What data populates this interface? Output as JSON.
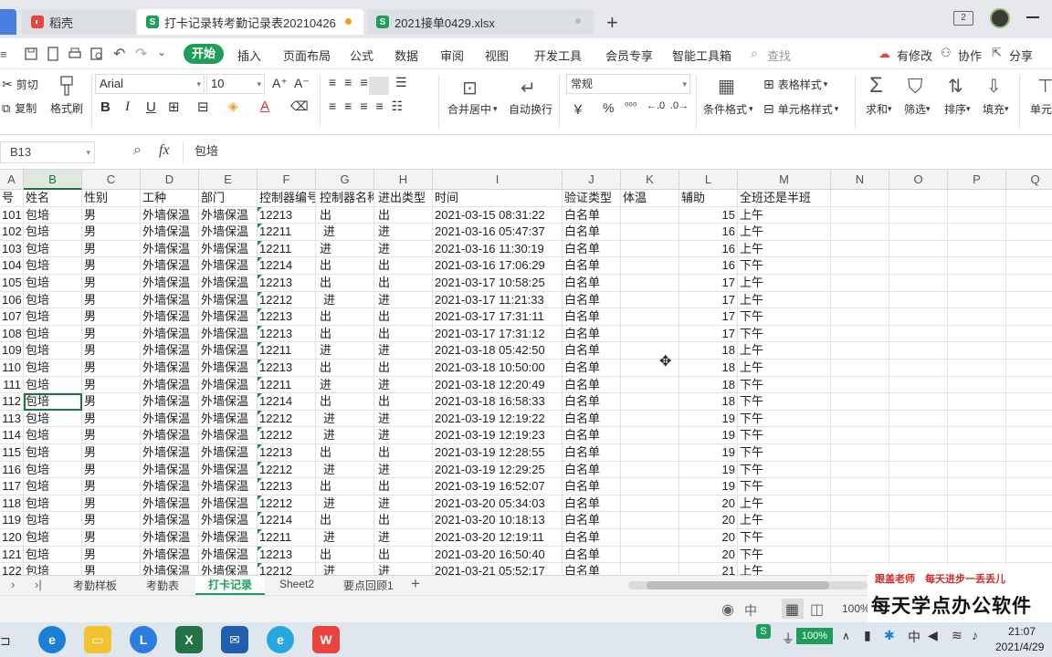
{
  "tabs": [
    {
      "label": "稻壳"
    },
    {
      "label": "打卡记录转考勤记录表20210426"
    },
    {
      "label": "2021接单0429.xlsx"
    }
  ],
  "tab_badge": "2",
  "menu": [
    "开始",
    "插入",
    "页面布局",
    "公式",
    "数据",
    "审阅",
    "视图",
    "开发工具",
    "会员专享",
    "智能工具箱"
  ],
  "search_label": "查找",
  "right_menu": [
    "有修改",
    "协作",
    "分享"
  ],
  "ribbon": {
    "cut": "剪切",
    "copy": "复制",
    "format_painter": "格式刷",
    "font_name": "Arial",
    "font_size": "10",
    "bold": "B",
    "italic": "I",
    "underline": "U",
    "merge": "合并居中",
    "wrap": "自动换行",
    "number_format": "常规",
    "currency": "￥",
    "percent": "%",
    "table_style": "表格样式",
    "cond_format": "条件格式",
    "cell_style": "单元格样式",
    "sum": "求和",
    "filter": "筛选",
    "sort": "排序",
    "fill": "填充",
    "cell": "单元"
  },
  "formula": {
    "cell_ref": "B13",
    "fx": "fx",
    "value": "包培"
  },
  "columns": [
    "A",
    "B",
    "C",
    "D",
    "E",
    "F",
    "G",
    "H",
    "I",
    "J",
    "K",
    "L",
    "M",
    "N",
    "O",
    "P",
    "Q"
  ],
  "header_row": [
    "号",
    "姓名",
    "性别",
    "工种",
    "部门",
    "控制器编号",
    "控制器名称",
    "进出类型",
    "时间",
    "验证类型",
    "体温",
    "辅助",
    "全班还是半班"
  ],
  "rows": [
    [
      "101",
      "包培",
      "男",
      "外墙保温",
      "外墙保温",
      "12213",
      "出",
      "出",
      "2021-03-15 08:31:22",
      "白名单",
      "",
      "15",
      "上午"
    ],
    [
      "102",
      "包培",
      "男",
      "外墙保温",
      "外墙保温",
      "12211",
      "进",
      "进",
      "2021-03-16 05:47:37",
      "白名单",
      "",
      "16",
      "上午"
    ],
    [
      "103",
      "包培",
      "男",
      "外墙保温",
      "外墙保温",
      "12211",
      "进",
      "进",
      "2021-03-16 11:30:19",
      "白名单",
      "",
      "16",
      "上午"
    ],
    [
      "104",
      "包培",
      "男",
      "外墙保温",
      "外墙保温",
      "12214",
      "出",
      "出",
      "2021-03-16 17:06:29",
      "白名单",
      "",
      "16",
      "下午"
    ],
    [
      "105",
      "包培",
      "男",
      "外墙保温",
      "外墙保温",
      "12213",
      "出",
      "出",
      "2021-03-17 10:58:25",
      "白名单",
      "",
      "17",
      "上午"
    ],
    [
      "106",
      "包培",
      "男",
      "外墙保温",
      "外墙保温",
      "12212",
      "进",
      "进",
      "2021-03-17 11:21:33",
      "白名单",
      "",
      "17",
      "上午"
    ],
    [
      "107",
      "包培",
      "男",
      "外墙保温",
      "外墙保温",
      "12213",
      "出",
      "出",
      "2021-03-17 17:31:11",
      "白名单",
      "",
      "17",
      "下午"
    ],
    [
      "108",
      "包培",
      "男",
      "外墙保温",
      "外墙保温",
      "12213",
      "出",
      "出",
      "2021-03-17 17:31:12",
      "白名单",
      "",
      "17",
      "下午"
    ],
    [
      "109",
      "包培",
      "男",
      "外墙保温",
      "外墙保温",
      "12211",
      "进",
      "进",
      "2021-03-18 05:42:50",
      "白名单",
      "",
      "18",
      "上午"
    ],
    [
      "110",
      "包培",
      "男",
      "外墙保温",
      "外墙保温",
      "12213",
      "出",
      "出",
      "2021-03-18 10:50:00",
      "白名单",
      "",
      "18",
      "上午"
    ],
    [
      "111",
      "包培",
      "男",
      "外墙保温",
      "外墙保温",
      "12211",
      "进",
      "进",
      "2021-03-18 12:20:49",
      "白名单",
      "",
      "18",
      "下午"
    ],
    [
      "112",
      "包培",
      "男",
      "外墙保温",
      "外墙保温",
      "12214",
      "出",
      "出",
      "2021-03-18 16:58:33",
      "白名单",
      "",
      "18",
      "下午"
    ],
    [
      "113",
      "包培",
      "男",
      "外墙保温",
      "外墙保温",
      "12212",
      "进",
      "进",
      "2021-03-19 12:19:22",
      "白名单",
      "",
      "19",
      "下午"
    ],
    [
      "114",
      "包培",
      "男",
      "外墙保温",
      "外墙保温",
      "12212",
      "进",
      "进",
      "2021-03-19 12:19:23",
      "白名单",
      "",
      "19",
      "下午"
    ],
    [
      "115",
      "包培",
      "男",
      "外墙保温",
      "外墙保温",
      "12213",
      "出",
      "出",
      "2021-03-19 12:28:55",
      "白名单",
      "",
      "19",
      "下午"
    ],
    [
      "116",
      "包培",
      "男",
      "外墙保温",
      "外墙保温",
      "12212",
      "进",
      "进",
      "2021-03-19 12:29:25",
      "白名单",
      "",
      "19",
      "下午"
    ],
    [
      "117",
      "包培",
      "男",
      "外墙保温",
      "外墙保温",
      "12213",
      "出",
      "出",
      "2021-03-19 16:52:07",
      "白名单",
      "",
      "19",
      "下午"
    ],
    [
      "118",
      "包培",
      "男",
      "外墙保温",
      "外墙保温",
      "12212",
      "进",
      "进",
      "2021-03-20 05:34:03",
      "白名单",
      "",
      "20",
      "上午"
    ],
    [
      "119",
      "包培",
      "男",
      "外墙保温",
      "外墙保温",
      "12214",
      "出",
      "出",
      "2021-03-20 10:18:13",
      "白名单",
      "",
      "20",
      "上午"
    ],
    [
      "120",
      "包培",
      "男",
      "外墙保温",
      "外墙保温",
      "12211",
      "进",
      "进",
      "2021-03-20 12:19:11",
      "白名单",
      "",
      "20",
      "下午"
    ],
    [
      "121",
      "包培",
      "男",
      "外墙保温",
      "外墙保温",
      "12213",
      "出",
      "出",
      "2021-03-20 16:50:40",
      "白名单",
      "",
      "20",
      "下午"
    ],
    [
      "122",
      "包培",
      "男",
      "外墙保温",
      "外墙保温",
      "12212",
      "进",
      "进",
      "2021-03-21 05:52:17",
      "白名单",
      "",
      "21",
      "上午"
    ]
  ],
  "selected_row_index": 11,
  "sheets": [
    "考勤样板",
    "考勤表",
    "打卡记录",
    "Sheet2",
    "要点回顾1"
  ],
  "active_sheet": "打卡记录",
  "zoom": "100%",
  "watermark": {
    "line1": "跟盖老师　每天进步一丢丢儿",
    "line2": "每天学点办公软件"
  },
  "taskbar": {
    "battery": "100%",
    "time": "21:07",
    "date": "2021/4/29"
  },
  "colors": {
    "accent": "#1e9e5a",
    "excel_green": "#217346",
    "wps_red": "#e8453c"
  }
}
